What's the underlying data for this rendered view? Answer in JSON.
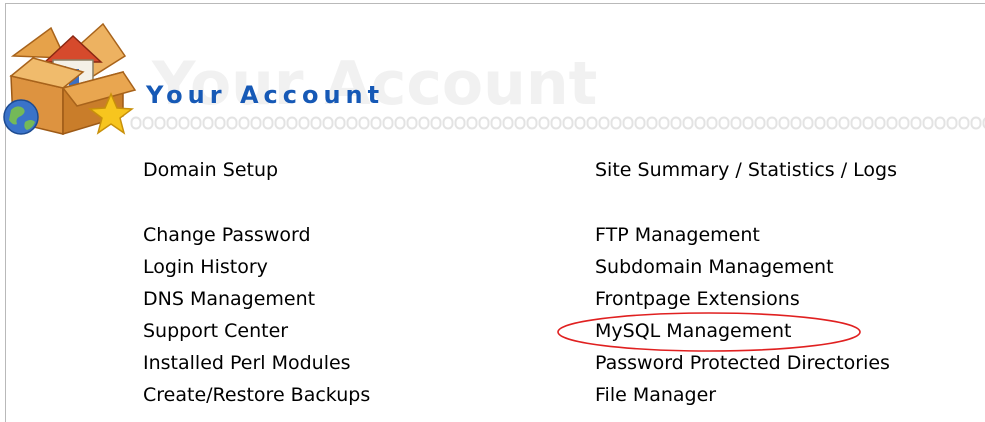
{
  "header": {
    "title": "Your Account",
    "ghost_title": "Your Account"
  },
  "menu": {
    "left": [
      "Domain Setup",
      "Change Password",
      "Login History",
      "DNS Management",
      "Support Center",
      "Installed Perl Modules",
      "Create/Restore Backups"
    ],
    "right": [
      "Site Summary / Statistics / Logs",
      "FTP Management",
      "Subdomain Management",
      "Frontpage Extensions",
      "MySQL Management",
      "Password Protected Directories",
      "File Manager"
    ]
  },
  "highlight": {
    "target": "MySQL Management",
    "color": "#e02020"
  },
  "colors": {
    "title": "#1659b6",
    "ghost_title": "#f1f1f1",
    "dots": "#e6e6e6",
    "frame": "#b9b9b9"
  },
  "icons": {
    "logo": "house-box-globe-star-icon"
  }
}
